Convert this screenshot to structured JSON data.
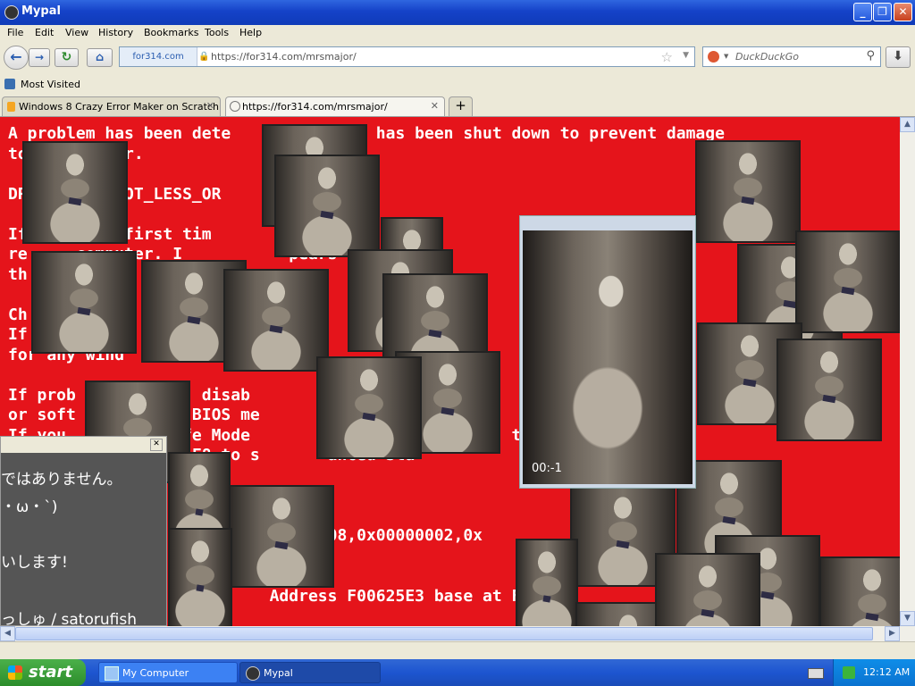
{
  "window": {
    "title": "Mypal"
  },
  "menu": [
    "File",
    "Edit",
    "View",
    "History",
    "Bookmarks",
    "Tools",
    "Help"
  ],
  "nav": {
    "site_identity": "for314.com",
    "url": "https://for314.com/mrsmajor/",
    "search_placeholder": "DuckDuckGo"
  },
  "bookmarks": {
    "most_visited": "Most Visited"
  },
  "tabs": [
    {
      "label": "Windows 8 Crazy Error Maker on Scratch"
    },
    {
      "label": "https://for314.com/mrsmajor/"
    }
  ],
  "page": {
    "bsod_lines": [
      "A problem has been dete       windows has been shut down to prevent damage",
      "to      puter.",
      "",
      "DR        _NOT_LESS_OR",
      "",
      "If      the first tim       his stop",
      "re     computer. I           pears o",
      "th",
      "",
      "Ch                                          ta",
      "If",
      "for any wind",
      "",
      "If prob       lnal, disab",
      "or soft       able BIOS me",
      "If you       se Safe Mode              or           t",
      "                   F8 to s       anced Sta",
      "",
      "",
      "",
      "                                008,0x00000002,0x",
      "",
      "",
      "                           Address F00625E3 base at F"
    ],
    "video_time": "00:-1",
    "chat_lines": [
      "ではありません。",
      "・ω・`)",
      "",
      "いします!",
      "",
      "っしゅ / satorufish"
    ]
  },
  "taskbar": {
    "start": "start",
    "items": [
      "My Computer",
      "Mypal"
    ],
    "clock": "12:12 AM"
  }
}
